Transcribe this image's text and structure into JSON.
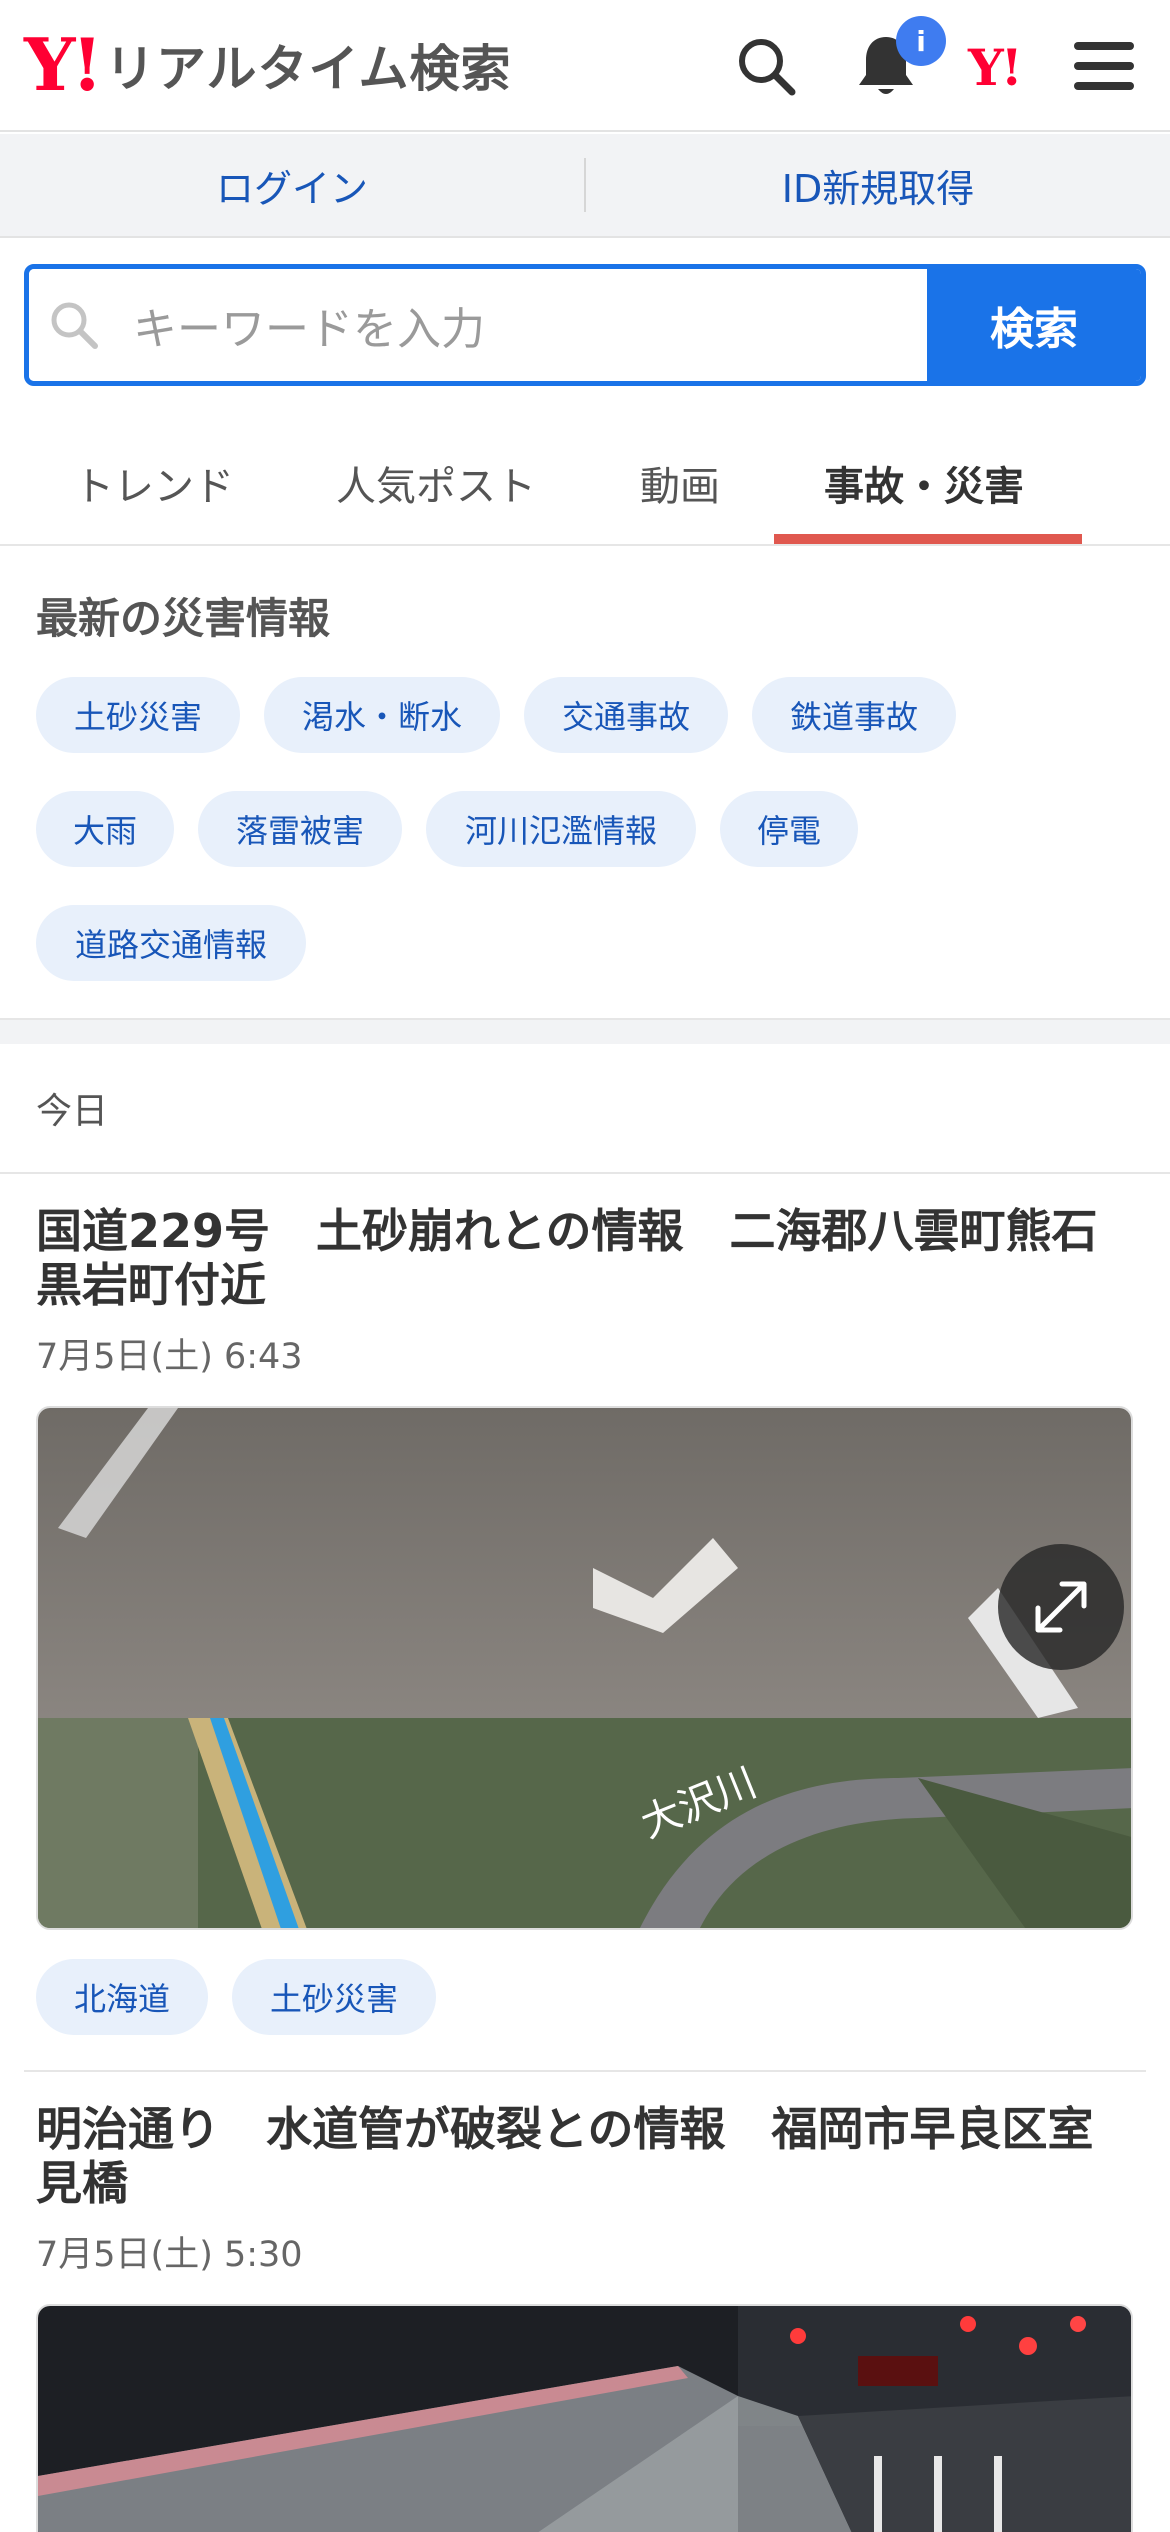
{
  "header": {
    "logo_y": "Y!",
    "logo_text": "リアルタイム検索",
    "badge": "i",
    "yahoo_mark": "Y!"
  },
  "login_bar": {
    "login": "ログイン",
    "register": "ID新規取得"
  },
  "search": {
    "placeholder": "キーワードを入力",
    "button": "検索"
  },
  "tabs": [
    {
      "label": "トレンド",
      "active": false
    },
    {
      "label": "人気ポスト",
      "active": false
    },
    {
      "label": "動画",
      "active": false
    },
    {
      "label": "事故・災害",
      "active": true
    }
  ],
  "disaster": {
    "title": "最新の災害情報",
    "chips": [
      "土砂災害",
      "渇水・断水",
      "交通事故",
      "鉄道事故",
      "大雨",
      "落雷被害",
      "河川氾濫情報",
      "停電",
      "道路交通情報"
    ]
  },
  "feed": {
    "date_label": "今日",
    "articles": [
      {
        "title": "国道229号　土砂崩れとの情報　二海郡八雲町熊石黒岩町付近",
        "time": "7月5日(土) 6:43",
        "image_text": "大沢川",
        "tags": [
          "北海道",
          "土砂災害"
        ]
      },
      {
        "title": "明治通り　水道管が破裂との情報　福岡市早良区室見橋",
        "time": "7月5日(土) 5:30"
      }
    ]
  },
  "icons": {
    "search": "search-icon",
    "bell": "bell-icon",
    "menu": "hamburger-menu-icon",
    "expand": "expand-icon"
  },
  "colors": {
    "brand_red": "#ff0033",
    "accent_blue": "#1a73e8",
    "tab_underline": "#e0584f",
    "chip_bg": "#e8f0fb",
    "chip_text": "#1856b8"
  }
}
